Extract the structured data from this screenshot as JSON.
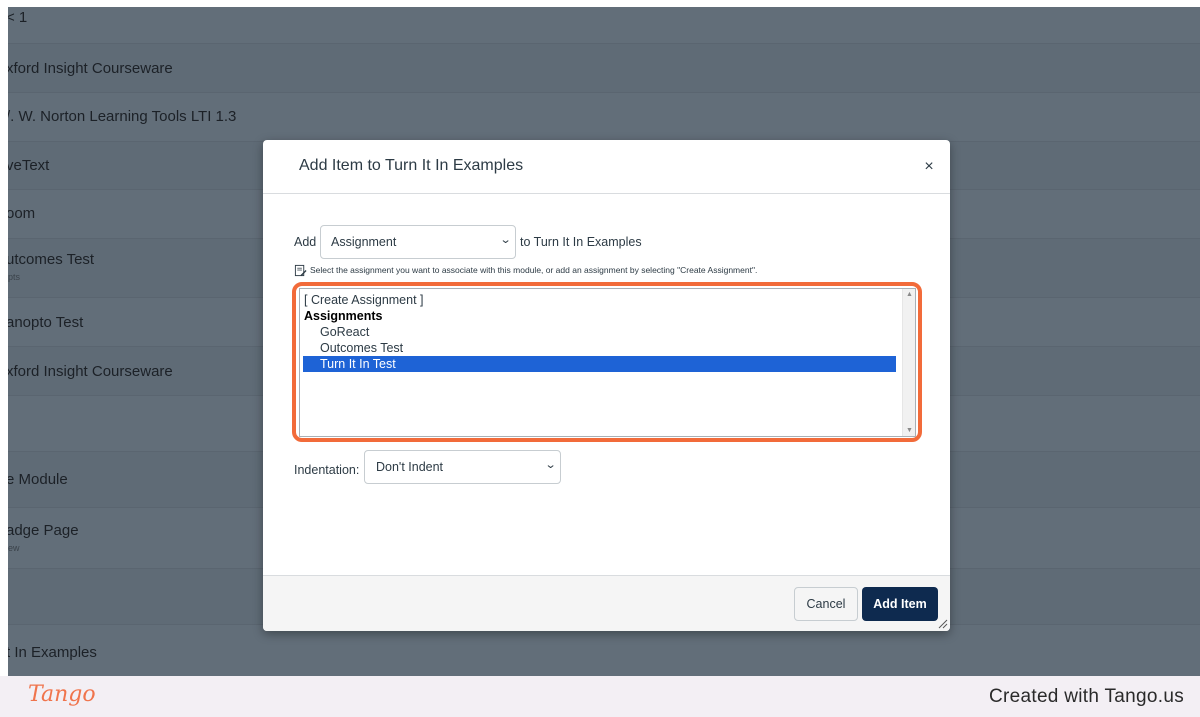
{
  "background": {
    "rows": [
      {
        "title": "< 1",
        "sub": ""
      },
      {
        "title": "xford Insight Courseware",
        "sub": ""
      },
      {
        "title": "/. W. Norton Learning Tools LTI 1.3",
        "sub": ""
      },
      {
        "title": "veText",
        "sub": ""
      },
      {
        "title": "oom",
        "sub": ""
      },
      {
        "title": "utcomes Test",
        "sub": "pts"
      },
      {
        "title": "anopto Test",
        "sub": ""
      },
      {
        "title": "xford Insight Courseware",
        "sub": ""
      },
      {
        "title": "",
        "sub": ""
      },
      {
        "title": "e Module",
        "sub": ""
      },
      {
        "title": "adge Page",
        "sub": "ew"
      },
      {
        "title": "",
        "sub": ""
      },
      {
        "title": "t In Examples",
        "sub": ""
      }
    ]
  },
  "dialog": {
    "title": "Add Item to Turn It In Examples",
    "close_label": "×",
    "add_label": "Add",
    "type_selected": "Assignment",
    "to_label": "to Turn It In Examples",
    "hint": "Select the assignment you want to associate with this module, or add an assignment by selecting \"Create Assignment\".",
    "list": {
      "create_option": "[ Create Assignment ]",
      "group_label": "Assignments",
      "items": [
        "GoReact",
        "Outcomes Test",
        "Turn It In Test"
      ],
      "selected": "Turn It In Test"
    },
    "indentation_label": "Indentation:",
    "indentation_selected": "Don't Indent",
    "cancel_label": "Cancel",
    "add_item_label": "Add Item"
  },
  "colors": {
    "highlight": "#f26b3a",
    "primary_button": "#0e2a4f",
    "selected_row": "#1e63d6",
    "overlay": "#626e79"
  },
  "footer": {
    "logo": "Tango",
    "credit": "Created with Tango.us"
  }
}
